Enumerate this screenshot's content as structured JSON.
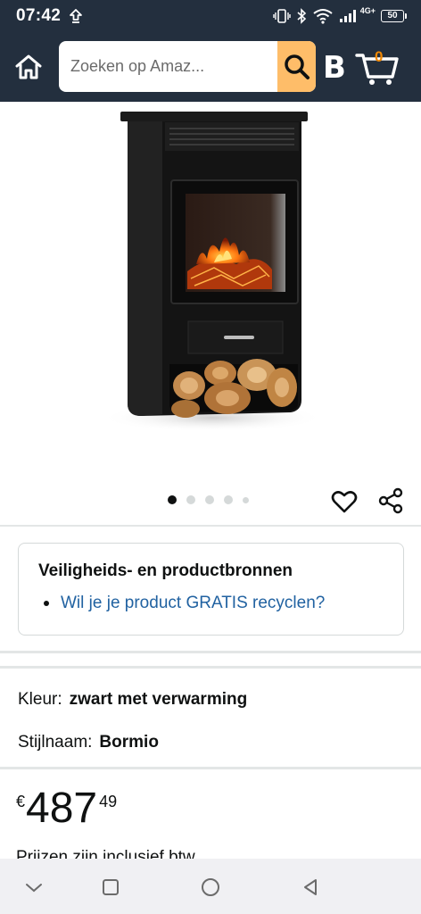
{
  "status_bar": {
    "time": "07:42",
    "network": "4G+",
    "battery": "50",
    "icons": [
      "upload-icon",
      "vibrate-icon",
      "bluetooth-icon",
      "wifi-icon",
      "signal-icon"
    ]
  },
  "header": {
    "search_placeholder": "Zoeken op Amaz...",
    "account_glyph": "B",
    "cart_count": "0",
    "colors": {
      "bar": "#232f3e",
      "search_button": "#febd69",
      "cart_count": "#f08804"
    }
  },
  "carousel": {
    "total_dots": 5,
    "active_index": 0
  },
  "safety": {
    "title": "Veiligheids- en productbronnen",
    "link": "Wil je je product GRATIS recyclen?"
  },
  "variations": {
    "color_label": "Kleur:",
    "color_value": "zwart met verwarming",
    "style_label": "Stijlnaam:",
    "style_value": "Bormio"
  },
  "price": {
    "currency": "€",
    "whole": "487",
    "fraction": "49",
    "note": "Prijzen zijn inclusief btw"
  },
  "nav": {
    "icons": [
      "chevron-down-icon",
      "recents-icon",
      "home-circle-icon",
      "back-icon"
    ]
  }
}
